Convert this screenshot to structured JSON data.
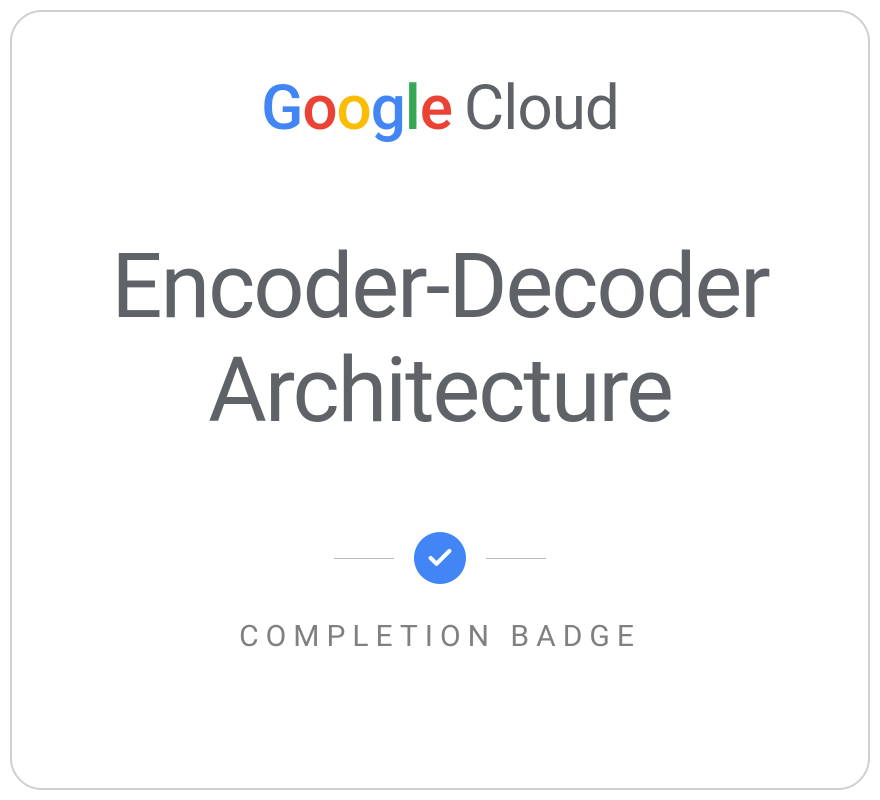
{
  "brand": {
    "google_letters": [
      "G",
      "o",
      "o",
      "g",
      "l",
      "e"
    ],
    "cloud": "Cloud"
  },
  "course": {
    "title_line1": "Encoder-Decoder",
    "title_line2": "Architecture"
  },
  "badge": {
    "label": "COMPLETION BADGE"
  },
  "colors": {
    "blue": "#4285F4",
    "red": "#EA4335",
    "yellow": "#FBBC05",
    "green": "#34A853",
    "gray": "#5f6368"
  }
}
